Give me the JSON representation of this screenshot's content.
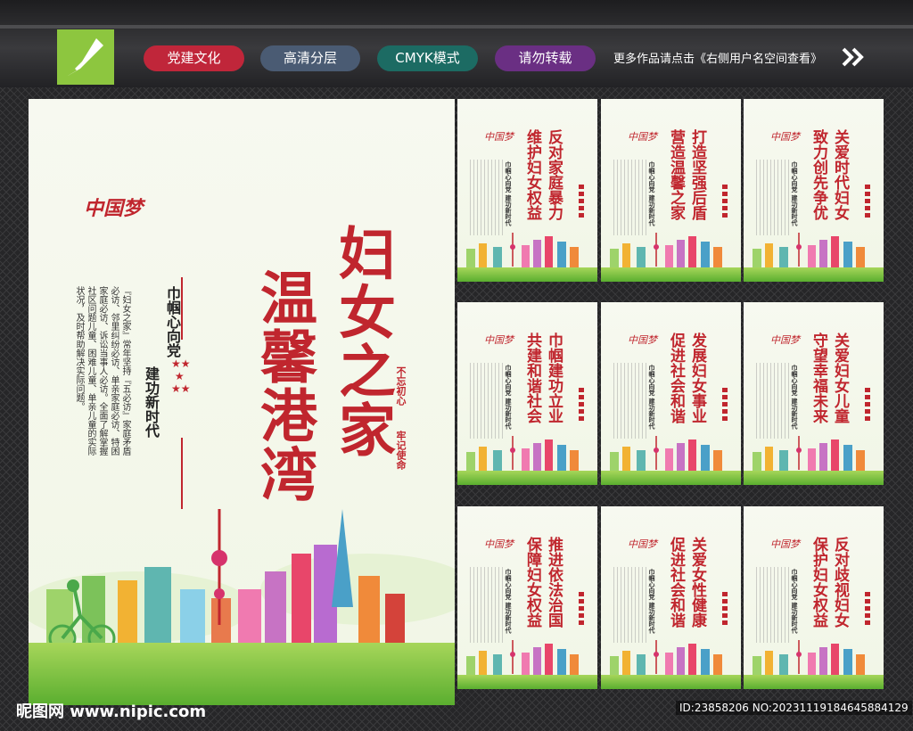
{
  "header": {
    "tags": [
      "党建文化",
      "高清分层",
      "CMYK模式",
      "请勿转载"
    ],
    "notice": "更多作品请点击《右侧用户名空间查看》"
  },
  "main_poster": {
    "logo_text": "中国梦",
    "title_line1": "妇女之家",
    "title_line2": "温馨港湾",
    "subtitle_line1": "巾帼心向党",
    "subtitle_line2": "建功新时代",
    "body": "『妇女之家』常年坚持『五必访』家庭矛盾必访、邻里纠纷必访、单亲家庭必访、特困家庭必访、诉讼当事人必访。全面了解掌握社区问题儿童、困难儿童、单亲儿童的实际状况，及时帮助解决实际问题。",
    "slogan1": "不忘初心",
    "slogan2": "牢记使命"
  },
  "small_posters": [
    {
      "line1": "反对家庭暴力",
      "line2": "维护妇女权益"
    },
    {
      "line1": "打造坚强后盾",
      "line2": "营造温馨之家"
    },
    {
      "line1": "关爱时代妇女",
      "line2": "致力创先争优"
    },
    {
      "line1": "巾帼建功立业",
      "line2": "共建和谐社会"
    },
    {
      "line1": "发展妇女事业",
      "line2": "促进社会和谐"
    },
    {
      "line1": "关爱妇女儿童",
      "line2": "守望幸福未来"
    },
    {
      "line1": "推进依法治国",
      "line2": "保障妇女权益"
    },
    {
      "line1": "关爱女性健康",
      "line2": "促进社会和谐"
    },
    {
      "line1": "反对歧视妇女",
      "line2": "保护妇女权益"
    }
  ],
  "small_poster_subtitle": "巾帼心向党 建功新时代",
  "footer": {
    "site": "昵图网 www.nipic.com",
    "id": "ID:23858206 NO:20231119184645884129"
  },
  "colors": {
    "accent_red": "#c0262e",
    "grass_green": "#5aae2f"
  }
}
